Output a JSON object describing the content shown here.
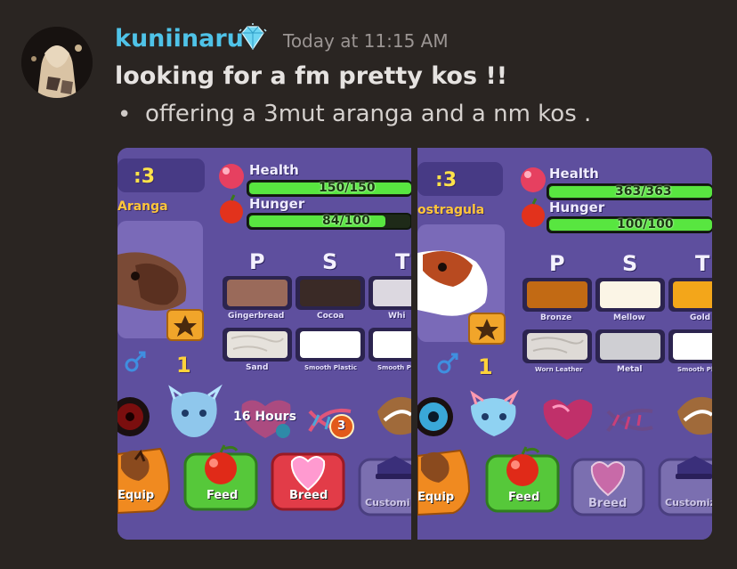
{
  "message": {
    "username": "kuniinaru",
    "badge_icon": "diamond-icon",
    "timestamp": "Today at 11:15 AM",
    "title": "looking for a fm pretty kos !!",
    "bullet": "offering a 3mut aranga and a nm kos ."
  },
  "pets": [
    {
      "level": ":3",
      "name": "Aranga",
      "health_label": "Health",
      "health_value": "150/150",
      "health_fraction": 1.0,
      "hunger_label": "Hunger",
      "hunger_value": "84/100",
      "hunger_fraction": 0.84,
      "traits": [
        "P",
        "S",
        "T"
      ],
      "swatches": [
        {
          "label": "Gingerbread",
          "color": "#9a6a5a"
        },
        {
          "label": "Cocoa",
          "color": "#3a2a26"
        },
        {
          "label": "Whi",
          "color": "#dcd8e0"
        },
        {
          "label": "Sand",
          "color": "#e6e2dc"
        },
        {
          "label": "Smooth Plastic",
          "color": "#ffffff"
        },
        {
          "label": "Smooth Pl",
          "color": "#ffffff"
        }
      ],
      "gender_icon": "male-icon",
      "count": "1",
      "hours": "16 Hours",
      "mutation_count": "3",
      "buttons": {
        "equip": "Equip",
        "feed": "Feed",
        "breed": "Breed",
        "customize": "Customi"
      }
    },
    {
      "level": ":3",
      "name": "ostragula",
      "health_label": "Health",
      "health_value": "363/363",
      "health_fraction": 1.0,
      "hunger_label": "Hunger",
      "hunger_value": "100/100",
      "hunger_fraction": 1.0,
      "traits": [
        "P",
        "S",
        "T"
      ],
      "swatches": [
        {
          "label": "Bronze",
          "color": "#c26a14"
        },
        {
          "label": "Mellow",
          "color": "#fbf5e6"
        },
        {
          "label": "Gold",
          "color": "#f3a61a"
        },
        {
          "label": "Worn Leather",
          "color": "#dedad6"
        },
        {
          "label": "Metal",
          "color": "#cfcfd3"
        },
        {
          "label": "Smooth Pl",
          "color": "#ffffff"
        }
      ],
      "gender_icon": "male-icon",
      "count": "1",
      "buttons": {
        "equip": "Equip",
        "feed": "Feed",
        "breed": "Breed",
        "customize": "Customiz"
      }
    }
  ]
}
